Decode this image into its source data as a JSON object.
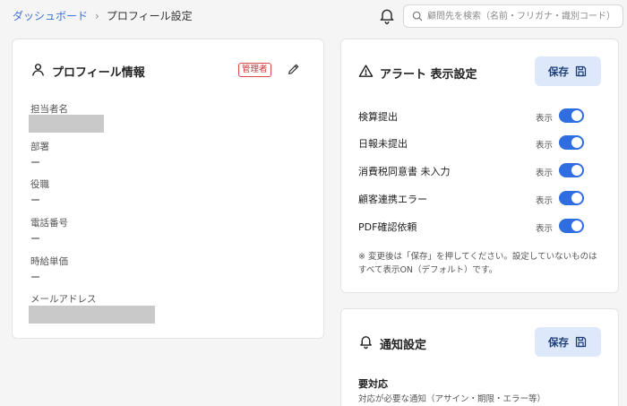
{
  "breadcrumb": {
    "home": "ダッシュボード",
    "separator": "›",
    "current": "プロフィール設定"
  },
  "search": {
    "placeholder": "顧問先を検索（名前・フリガナ・識別コード）"
  },
  "profile": {
    "title": "プロフィール情報",
    "badge": "管理者",
    "fields": [
      {
        "label": "担当者名",
        "value": ""
      },
      {
        "label": "部署",
        "value": "ー"
      },
      {
        "label": "役職",
        "value": "ー"
      },
      {
        "label": "電話番号",
        "value": "ー"
      },
      {
        "label": "時給単価",
        "value": "ー"
      },
      {
        "label": "メールアドレス",
        "value": ""
      }
    ]
  },
  "alert": {
    "title": "アラート 表示設定",
    "save_label": "保存",
    "rows": [
      {
        "label": "検算提出",
        "state": "表示",
        "on": true
      },
      {
        "label": "日報未提出",
        "state": "表示",
        "on": true
      },
      {
        "label": "消費税同意書 未入力",
        "state": "表示",
        "on": true
      },
      {
        "label": "顧客連携エラー",
        "state": "表示",
        "on": true
      },
      {
        "label": "PDF確認依頼",
        "state": "表示",
        "on": true
      }
    ],
    "note": "※ 変更後は「保存」を押してください。設定していないものはすべて表示ON（デフォルト）です。"
  },
  "notify": {
    "title": "通知設定",
    "save_label": "保存",
    "section_title": "要対応",
    "section_desc": "対応が必要な通知（アサイン・期限・エラー等）"
  },
  "colors": {
    "accent": "#2f6de0",
    "link": "#3d72d9",
    "save_bg": "#dde9fb",
    "badge": "#d02f2f"
  }
}
